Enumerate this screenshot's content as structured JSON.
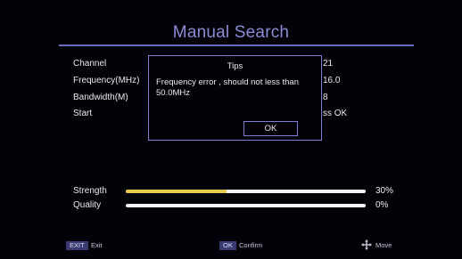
{
  "screen": {
    "title": "Manual Search"
  },
  "fields": [
    {
      "label": "Channel",
      "value": "21"
    },
    {
      "label": "Frequency(MHz)",
      "value": "16.0"
    },
    {
      "label": "Bandwidth(M)",
      "value": "8"
    },
    {
      "label": "Start",
      "value": "ss OK"
    }
  ],
  "dialog": {
    "title": "Tips",
    "message": "Frequency error , should not less than 50.0MHz",
    "ok_label": "OK"
  },
  "signal": {
    "strength_label": "Strength",
    "strength_value": "30%",
    "strength_level": 0.42,
    "quality_label": "Quality",
    "quality_value": "0%",
    "quality_level": 0
  },
  "footer": {
    "exit_key": "EXIT",
    "exit_label": "Exit",
    "ok_key": "OK",
    "confirm_label": "Confirm",
    "move_icon": "move-arrows-icon",
    "move_label": "Move"
  },
  "colors": {
    "accent": "#7c7ed8",
    "title": "#8a8cd6",
    "strength_fill": "#e8c94a",
    "key_bg": "#3a3a72"
  }
}
